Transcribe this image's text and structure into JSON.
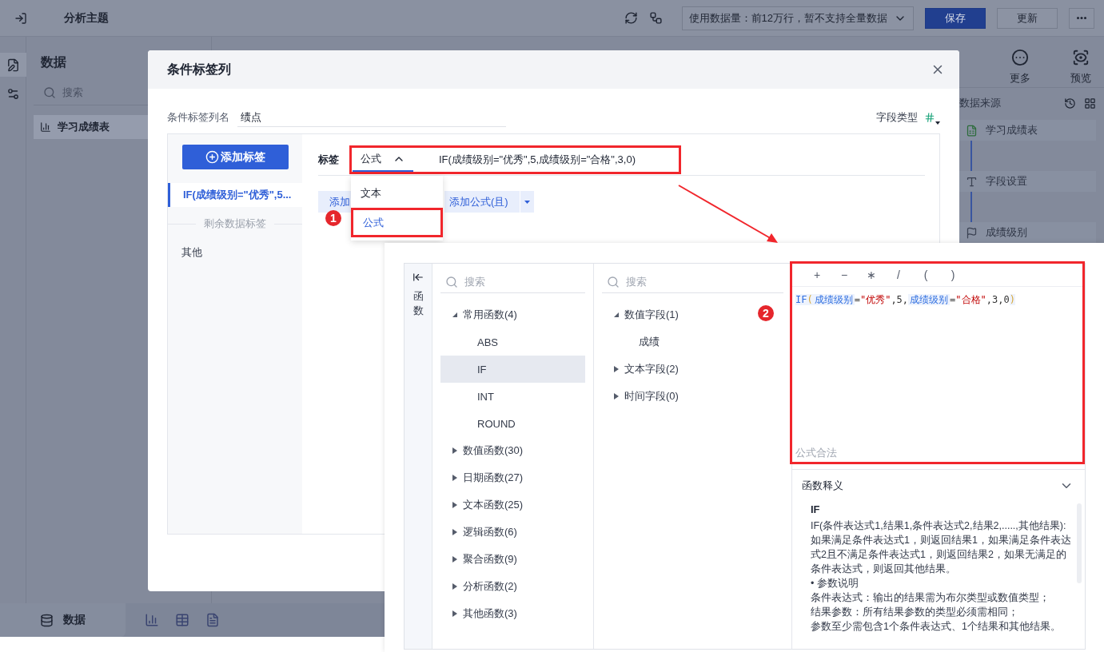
{
  "topbar": {
    "title": "分析主题",
    "data_usage": "使用数据量：前12万行，暂不支持全量数据",
    "save": "保存",
    "update": "更新"
  },
  "rail": [
    {
      "kind": "edit",
      "selected": true
    },
    {
      "kind": "settings",
      "selected": false
    }
  ],
  "data_panel": {
    "title": "数据",
    "search_placeholder": "搜索",
    "items": [
      {
        "label": "学习成绩表",
        "selected": true
      }
    ]
  },
  "toolbar": [
    {
      "kind": "more",
      "label": "更多"
    },
    {
      "kind": "preview",
      "label": "预览"
    }
  ],
  "source_panel": {
    "title": "数据来源",
    "steps": [
      {
        "kind": "table",
        "label": "学习成绩表"
      },
      {
        "kind": "field",
        "label": "字段设置"
      },
      {
        "kind": "label",
        "label": "成绩级别"
      }
    ]
  },
  "bottom_bar": {
    "tab": "数据"
  },
  "dialog": {
    "title": "条件标签列",
    "name_label": "条件标签列名",
    "name_value": "绩点",
    "type_label": "字段类型",
    "add_button": "添加标签",
    "label_items": [
      {
        "label": "IF(成绩级别=\"优秀\",5...",
        "selected": true
      }
    ],
    "remaining_title": "剩余数据标签",
    "remaining_items": [
      {
        "label": "其他",
        "selected": false
      }
    ],
    "tag_label": "标签",
    "mode": "公式",
    "mode_expanded": true,
    "formula": "IF(成绩级别=\"优秀\",5,成绩级别=\"合格\",3,0)",
    "buttons": [
      {
        "label": "添加",
        "split": false
      },
      {
        "label": "添加公式(且)",
        "split": true
      }
    ],
    "mode_options": [
      {
        "label": "文本",
        "selected": false
      },
      {
        "label": "公式",
        "selected": true
      }
    ]
  },
  "annotations": [
    "1",
    "2"
  ],
  "formula_panel": {
    "rail_label": "函数",
    "function_search": "搜索",
    "functions": [
      {
        "label": "常用函数(4)",
        "expanded": true,
        "children": [
          {
            "label": "ABS",
            "selected": false
          },
          {
            "label": "IF",
            "selected": true
          },
          {
            "label": "INT",
            "selected": false
          },
          {
            "label": "ROUND",
            "selected": false
          }
        ]
      },
      {
        "label": "数值函数(30)",
        "expanded": false
      },
      {
        "label": "日期函数(27)",
        "expanded": false
      },
      {
        "label": "文本函数(25)",
        "expanded": false
      },
      {
        "label": "逻辑函数(6)",
        "expanded": false
      },
      {
        "label": "聚合函数(9)",
        "expanded": false
      },
      {
        "label": "分析函数(2)",
        "expanded": false
      },
      {
        "label": "其他函数(3)",
        "expanded": false
      }
    ],
    "field_search": "搜索",
    "fields": [
      {
        "label": "数值字段(1)",
        "expanded": true,
        "children": [
          {
            "label": "成绩"
          }
        ]
      },
      {
        "label": "文本字段(2)",
        "expanded": false
      },
      {
        "label": "时间字段(0)",
        "expanded": false
      }
    ],
    "operators": [
      "+",
      "−",
      "∗",
      "/",
      "(",
      ")"
    ],
    "tokens": [
      {
        "kind": "func",
        "text": "IF"
      },
      {
        "kind": "paren",
        "text": "("
      },
      {
        "kind": "field",
        "text": "成绩级别"
      },
      {
        "kind": "plain",
        "text": "="
      },
      {
        "kind": "string",
        "text": "\"优秀\""
      },
      {
        "kind": "plain",
        "text": ",5,"
      },
      {
        "kind": "field",
        "text": "成绩级别"
      },
      {
        "kind": "plain",
        "text": "="
      },
      {
        "kind": "string",
        "text": "\"合格\""
      },
      {
        "kind": "plain",
        "text": ",3,0"
      },
      {
        "kind": "paren",
        "text": ")"
      }
    ],
    "status": "公式合法",
    "help_title": "函数释义",
    "help_expanded": true,
    "help_name": "IF",
    "help_lines": [
      "IF(条件表达式1,结果1,条件表达式2,结果2,.....,其他结果):如果满足条件表达式1，则返回结果1，如果满足条件表达式2且不满足条件表达式1，则返回结果2，如果无满足的条件表达式，则返回其他结果。",
      "• 参数说明",
      "条件表达式：输出的结果需为布尔类型或数值类型；",
      "结果参数：所有结果参数的类型必须需相同；",
      "参数至少需包含1个条件表达式、1个结果和其他结果。"
    ]
  }
}
